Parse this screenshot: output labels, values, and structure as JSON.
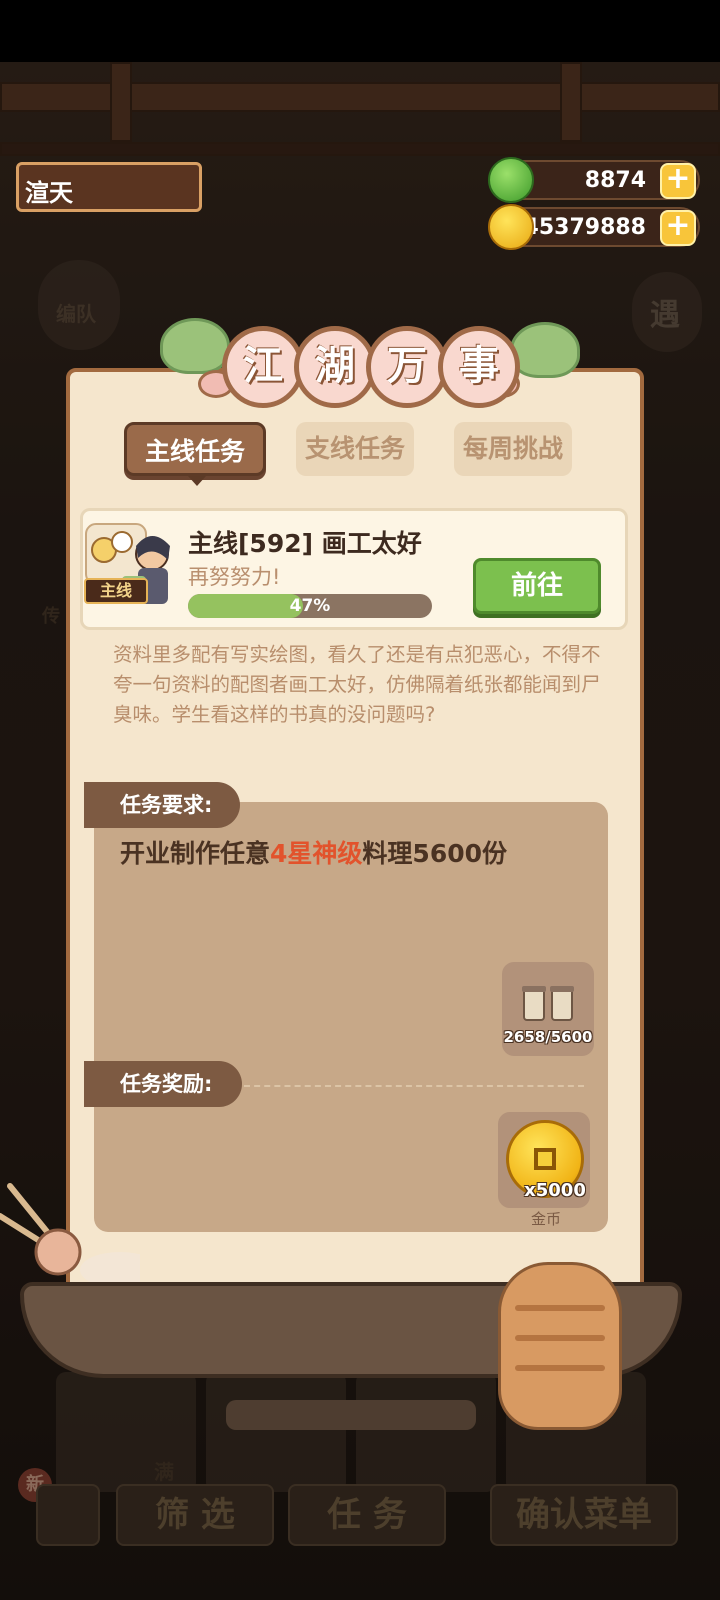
{
  "player": {
    "name": "渲天"
  },
  "resources": {
    "jade": {
      "icon": "jade-icon",
      "value": "8874",
      "color": "#4fb83a"
    },
    "gold": {
      "icon": "coin-icon",
      "value": "45379888",
      "color": "#f1b416"
    }
  },
  "background": {
    "team_label": "编队",
    "side_label_right": "遇",
    "side_label_left": "传",
    "full_label": "满",
    "bottom_buttons": [
      "筛 选",
      "任 务",
      "确认菜单"
    ],
    "new_badge": "新"
  },
  "panel": {
    "title_chars": [
      "江",
      "湖",
      "万",
      "事"
    ],
    "tabs": [
      {
        "label": "主线任务",
        "active": true
      },
      {
        "label": "支线任务",
        "active": false
      },
      {
        "label": "每周挑战",
        "active": false
      }
    ],
    "quest": {
      "badge": "主线",
      "title": "主线[592] 画工太好",
      "subtitle": "再努努力!",
      "progress": 0.47,
      "progress_label": "47%",
      "go_button": "前往"
    },
    "description": "资料里多配有写实绘图，看久了还是有点犯恶心，不得不夸一句资料的配图者画工太好，仿佛隔着纸张都能闻到尸臭味。学生看这样的书真的没问题吗?",
    "requirement": {
      "label": "任务要求:",
      "text_prefix": "开业制作任意",
      "text_highlight": "4星神级",
      "text_suffix": "料理5600份",
      "highlight_color": "#e2532c",
      "item_icon": "scroll-icon",
      "item_count": "2658/5600"
    },
    "reward": {
      "label": "任务奖励:",
      "icon": "gold-coin-icon",
      "amount": "x5000",
      "name": "金币"
    }
  }
}
